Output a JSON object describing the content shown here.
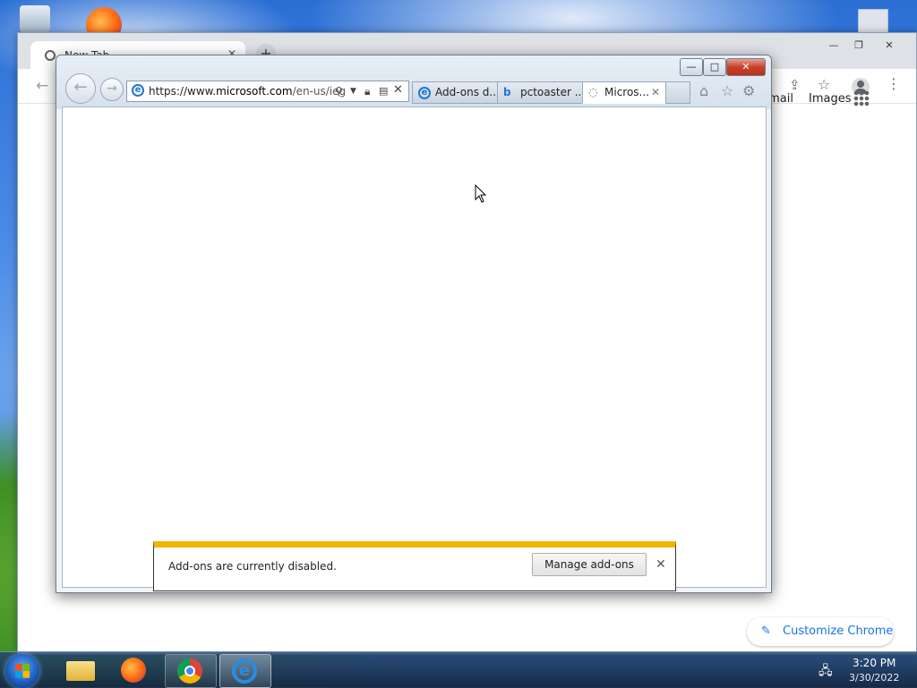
{
  "chrome": {
    "tab_title": "New Tab",
    "links": {
      "gmail": "Gmail",
      "images": "Images"
    },
    "customize_label": "Customize Chrome",
    "new_tab_symbol": "+"
  },
  "ie": {
    "window_buttons": {
      "minimize": "—",
      "maximize": "□",
      "close": "✕"
    },
    "address": {
      "scheme": "https://www.",
      "domain": "microsoft.com",
      "path": "/en-us/ieg"
    },
    "tabs": [
      {
        "label": "Add-ons d...",
        "icon": "ie-icon"
      },
      {
        "label": "pctoaster ...",
        "icon": "bing-icon"
      },
      {
        "label": "Micros...",
        "icon": "loading-icon",
        "active": true
      }
    ],
    "notification": {
      "message": "Add-ons are currently disabled.",
      "button": "Manage add-ons",
      "accent": "#f0b400"
    }
  },
  "taskbar": {
    "items": [
      "windows-explorer",
      "firefox",
      "chrome",
      "internet-explorer"
    ],
    "time": "3:20 PM",
    "date": "3/30/2022"
  }
}
